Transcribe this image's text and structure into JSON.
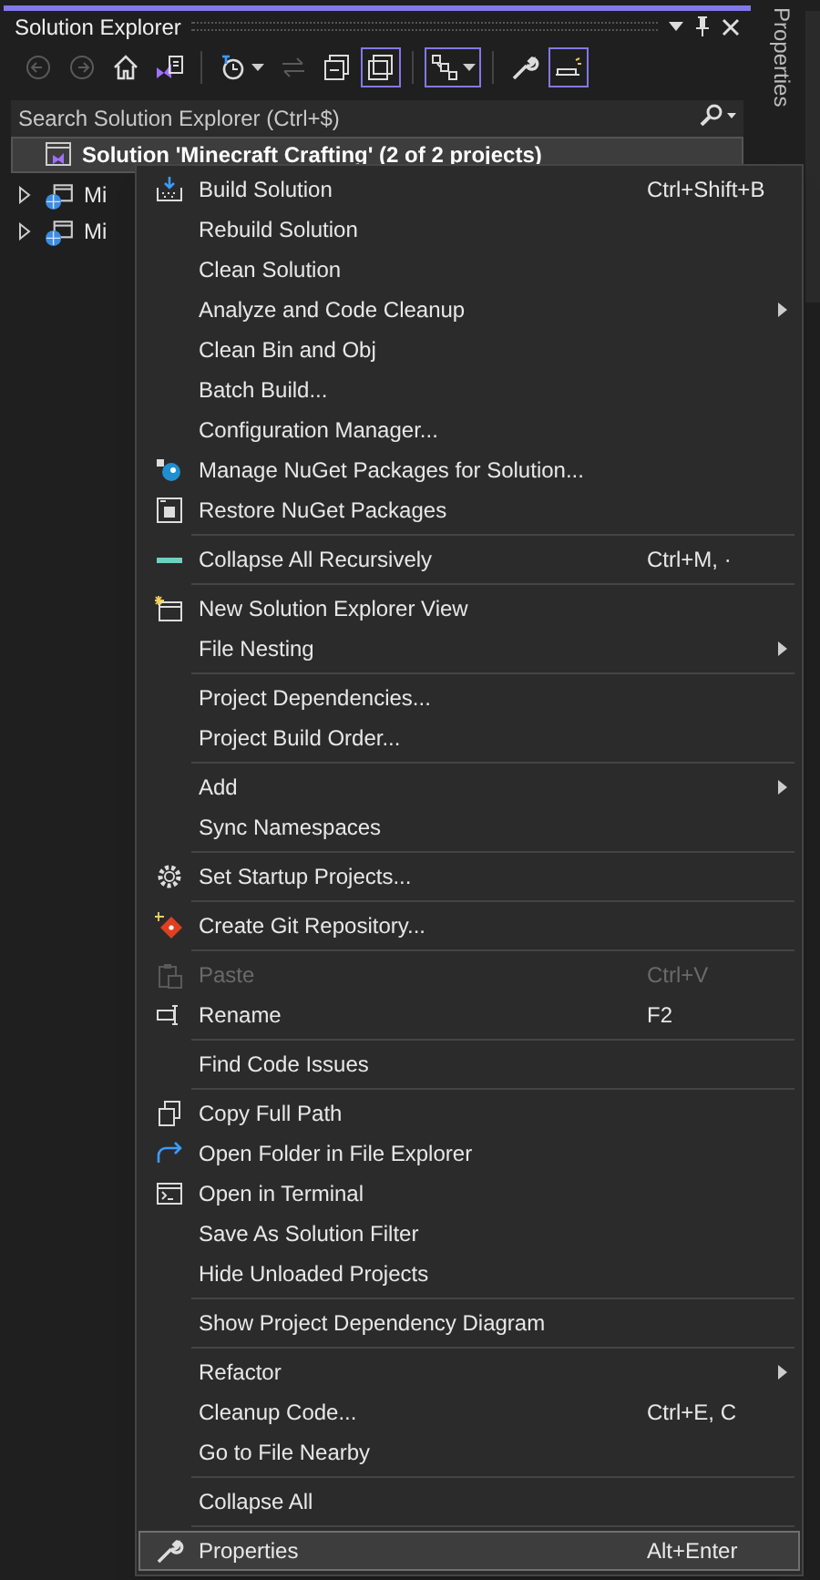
{
  "panel": {
    "title": "Solution Explorer",
    "side_tab": "Properties"
  },
  "toolbar": [
    {
      "disabled": true,
      "selected": false,
      "dropdown": false
    },
    {
      "disabled": true,
      "selected": false,
      "dropdown": false
    },
    {
      "disabled": false,
      "selected": false,
      "dropdown": false
    },
    {
      "disabled": false,
      "selected": false,
      "dropdown": false
    },
    {
      "kind": "separator"
    },
    {
      "disabled": false,
      "selected": false,
      "dropdown": true
    },
    {
      "disabled": true,
      "selected": false,
      "dropdown": false
    },
    {
      "disabled": false,
      "selected": false,
      "dropdown": false
    },
    {
      "disabled": false,
      "selected": true,
      "dropdown": false
    },
    {
      "kind": "separator"
    },
    {
      "disabled": false,
      "selected": true,
      "dropdown": true
    },
    {
      "kind": "separator"
    },
    {
      "disabled": false,
      "selected": false,
      "dropdown": false
    },
    {
      "disabled": false,
      "selected": true,
      "dropdown": false
    }
  ],
  "search": {
    "placeholder": "Search Solution Explorer (Ctrl+$)"
  },
  "tree": [
    {
      "kind": "solution",
      "label": "Solution 'Minecraft Crafting' (2 of 2 projects)",
      "selected": true
    },
    {
      "kind": "project",
      "label": "Mi",
      "selected": false,
      "expanded": false
    },
    {
      "kind": "project",
      "label": "Mi",
      "selected": false,
      "expanded": false
    }
  ],
  "context_menu": [
    {
      "kind": "item",
      "label": "Build Solution",
      "shortcut": "Ctrl+Shift+B",
      "submenu": false,
      "disabled": false,
      "selected": false
    },
    {
      "kind": "item",
      "label": "Rebuild Solution",
      "submenu": false,
      "disabled": false,
      "selected": false
    },
    {
      "kind": "item",
      "label": "Clean Solution",
      "submenu": false,
      "disabled": false,
      "selected": false
    },
    {
      "kind": "item",
      "label": "Analyze and Code Cleanup",
      "submenu": true,
      "disabled": false,
      "selected": false
    },
    {
      "kind": "item",
      "label": "Clean Bin and Obj",
      "submenu": false,
      "disabled": false,
      "selected": false
    },
    {
      "kind": "item",
      "label": "Batch Build...",
      "submenu": false,
      "disabled": false,
      "selected": false
    },
    {
      "kind": "item",
      "label": "Configuration Manager...",
      "submenu": false,
      "disabled": false,
      "selected": false
    },
    {
      "kind": "item",
      "label": "Manage NuGet Packages for Solution...",
      "submenu": false,
      "disabled": false,
      "selected": false
    },
    {
      "kind": "item",
      "label": "Restore NuGet Packages",
      "submenu": false,
      "disabled": false,
      "selected": false
    },
    {
      "kind": "separator"
    },
    {
      "kind": "item",
      "label": "Collapse All Recursively",
      "shortcut": "Ctrl+M, ·",
      "submenu": false,
      "disabled": false,
      "selected": false
    },
    {
      "kind": "separator"
    },
    {
      "kind": "item",
      "label": "New Solution Explorer View",
      "submenu": false,
      "disabled": false,
      "selected": false
    },
    {
      "kind": "item",
      "label": "File Nesting",
      "submenu": true,
      "disabled": false,
      "selected": false
    },
    {
      "kind": "separator"
    },
    {
      "kind": "item",
      "label": "Project Dependencies...",
      "submenu": false,
      "disabled": false,
      "selected": false
    },
    {
      "kind": "item",
      "label": "Project Build Order...",
      "submenu": false,
      "disabled": false,
      "selected": false
    },
    {
      "kind": "separator"
    },
    {
      "kind": "item",
      "label": "Add",
      "submenu": true,
      "disabled": false,
      "selected": false
    },
    {
      "kind": "item",
      "label": "Sync Namespaces",
      "submenu": false,
      "disabled": false,
      "selected": false
    },
    {
      "kind": "separator"
    },
    {
      "kind": "item",
      "label": "Set Startup Projects...",
      "submenu": false,
      "disabled": false,
      "selected": false
    },
    {
      "kind": "separator"
    },
    {
      "kind": "item",
      "label": "Create Git Repository...",
      "submenu": false,
      "disabled": false,
      "selected": false
    },
    {
      "kind": "separator"
    },
    {
      "kind": "item",
      "label": "Paste",
      "shortcut": "Ctrl+V",
      "submenu": false,
      "disabled": true,
      "selected": false
    },
    {
      "kind": "item",
      "label": "Rename",
      "shortcut": "F2",
      "submenu": false,
      "disabled": false,
      "selected": false
    },
    {
      "kind": "separator"
    },
    {
      "kind": "item",
      "label": "Find Code Issues",
      "submenu": false,
      "disabled": false,
      "selected": false
    },
    {
      "kind": "separator"
    },
    {
      "kind": "item",
      "label": "Copy Full Path",
      "submenu": false,
      "disabled": false,
      "selected": false
    },
    {
      "kind": "item",
      "label": "Open Folder in File Explorer",
      "submenu": false,
      "disabled": false,
      "selected": false
    },
    {
      "kind": "item",
      "label": "Open in Terminal",
      "submenu": false,
      "disabled": false,
      "selected": false
    },
    {
      "kind": "item",
      "label": "Save As Solution Filter",
      "submenu": false,
      "disabled": false,
      "selected": false
    },
    {
      "kind": "item",
      "label": "Hide Unloaded Projects",
      "submenu": false,
      "disabled": false,
      "selected": false
    },
    {
      "kind": "separator"
    },
    {
      "kind": "item",
      "label": "Show Project Dependency Diagram",
      "submenu": false,
      "disabled": false,
      "selected": false
    },
    {
      "kind": "separator"
    },
    {
      "kind": "item",
      "label": "Refactor",
      "submenu": true,
      "disabled": false,
      "selected": false
    },
    {
      "kind": "item",
      "label": "Cleanup Code...",
      "shortcut": "Ctrl+E, C",
      "submenu": false,
      "disabled": false,
      "selected": false
    },
    {
      "kind": "item",
      "label": "Go to File Nearby",
      "submenu": false,
      "disabled": false,
      "selected": false
    },
    {
      "kind": "separator"
    },
    {
      "kind": "item",
      "label": "Collapse All",
      "submenu": false,
      "disabled": false,
      "selected": false
    },
    {
      "kind": "separator"
    },
    {
      "kind": "item",
      "label": "Properties",
      "shortcut": "Alt+Enter",
      "submenu": false,
      "disabled": false,
      "selected": true
    }
  ]
}
